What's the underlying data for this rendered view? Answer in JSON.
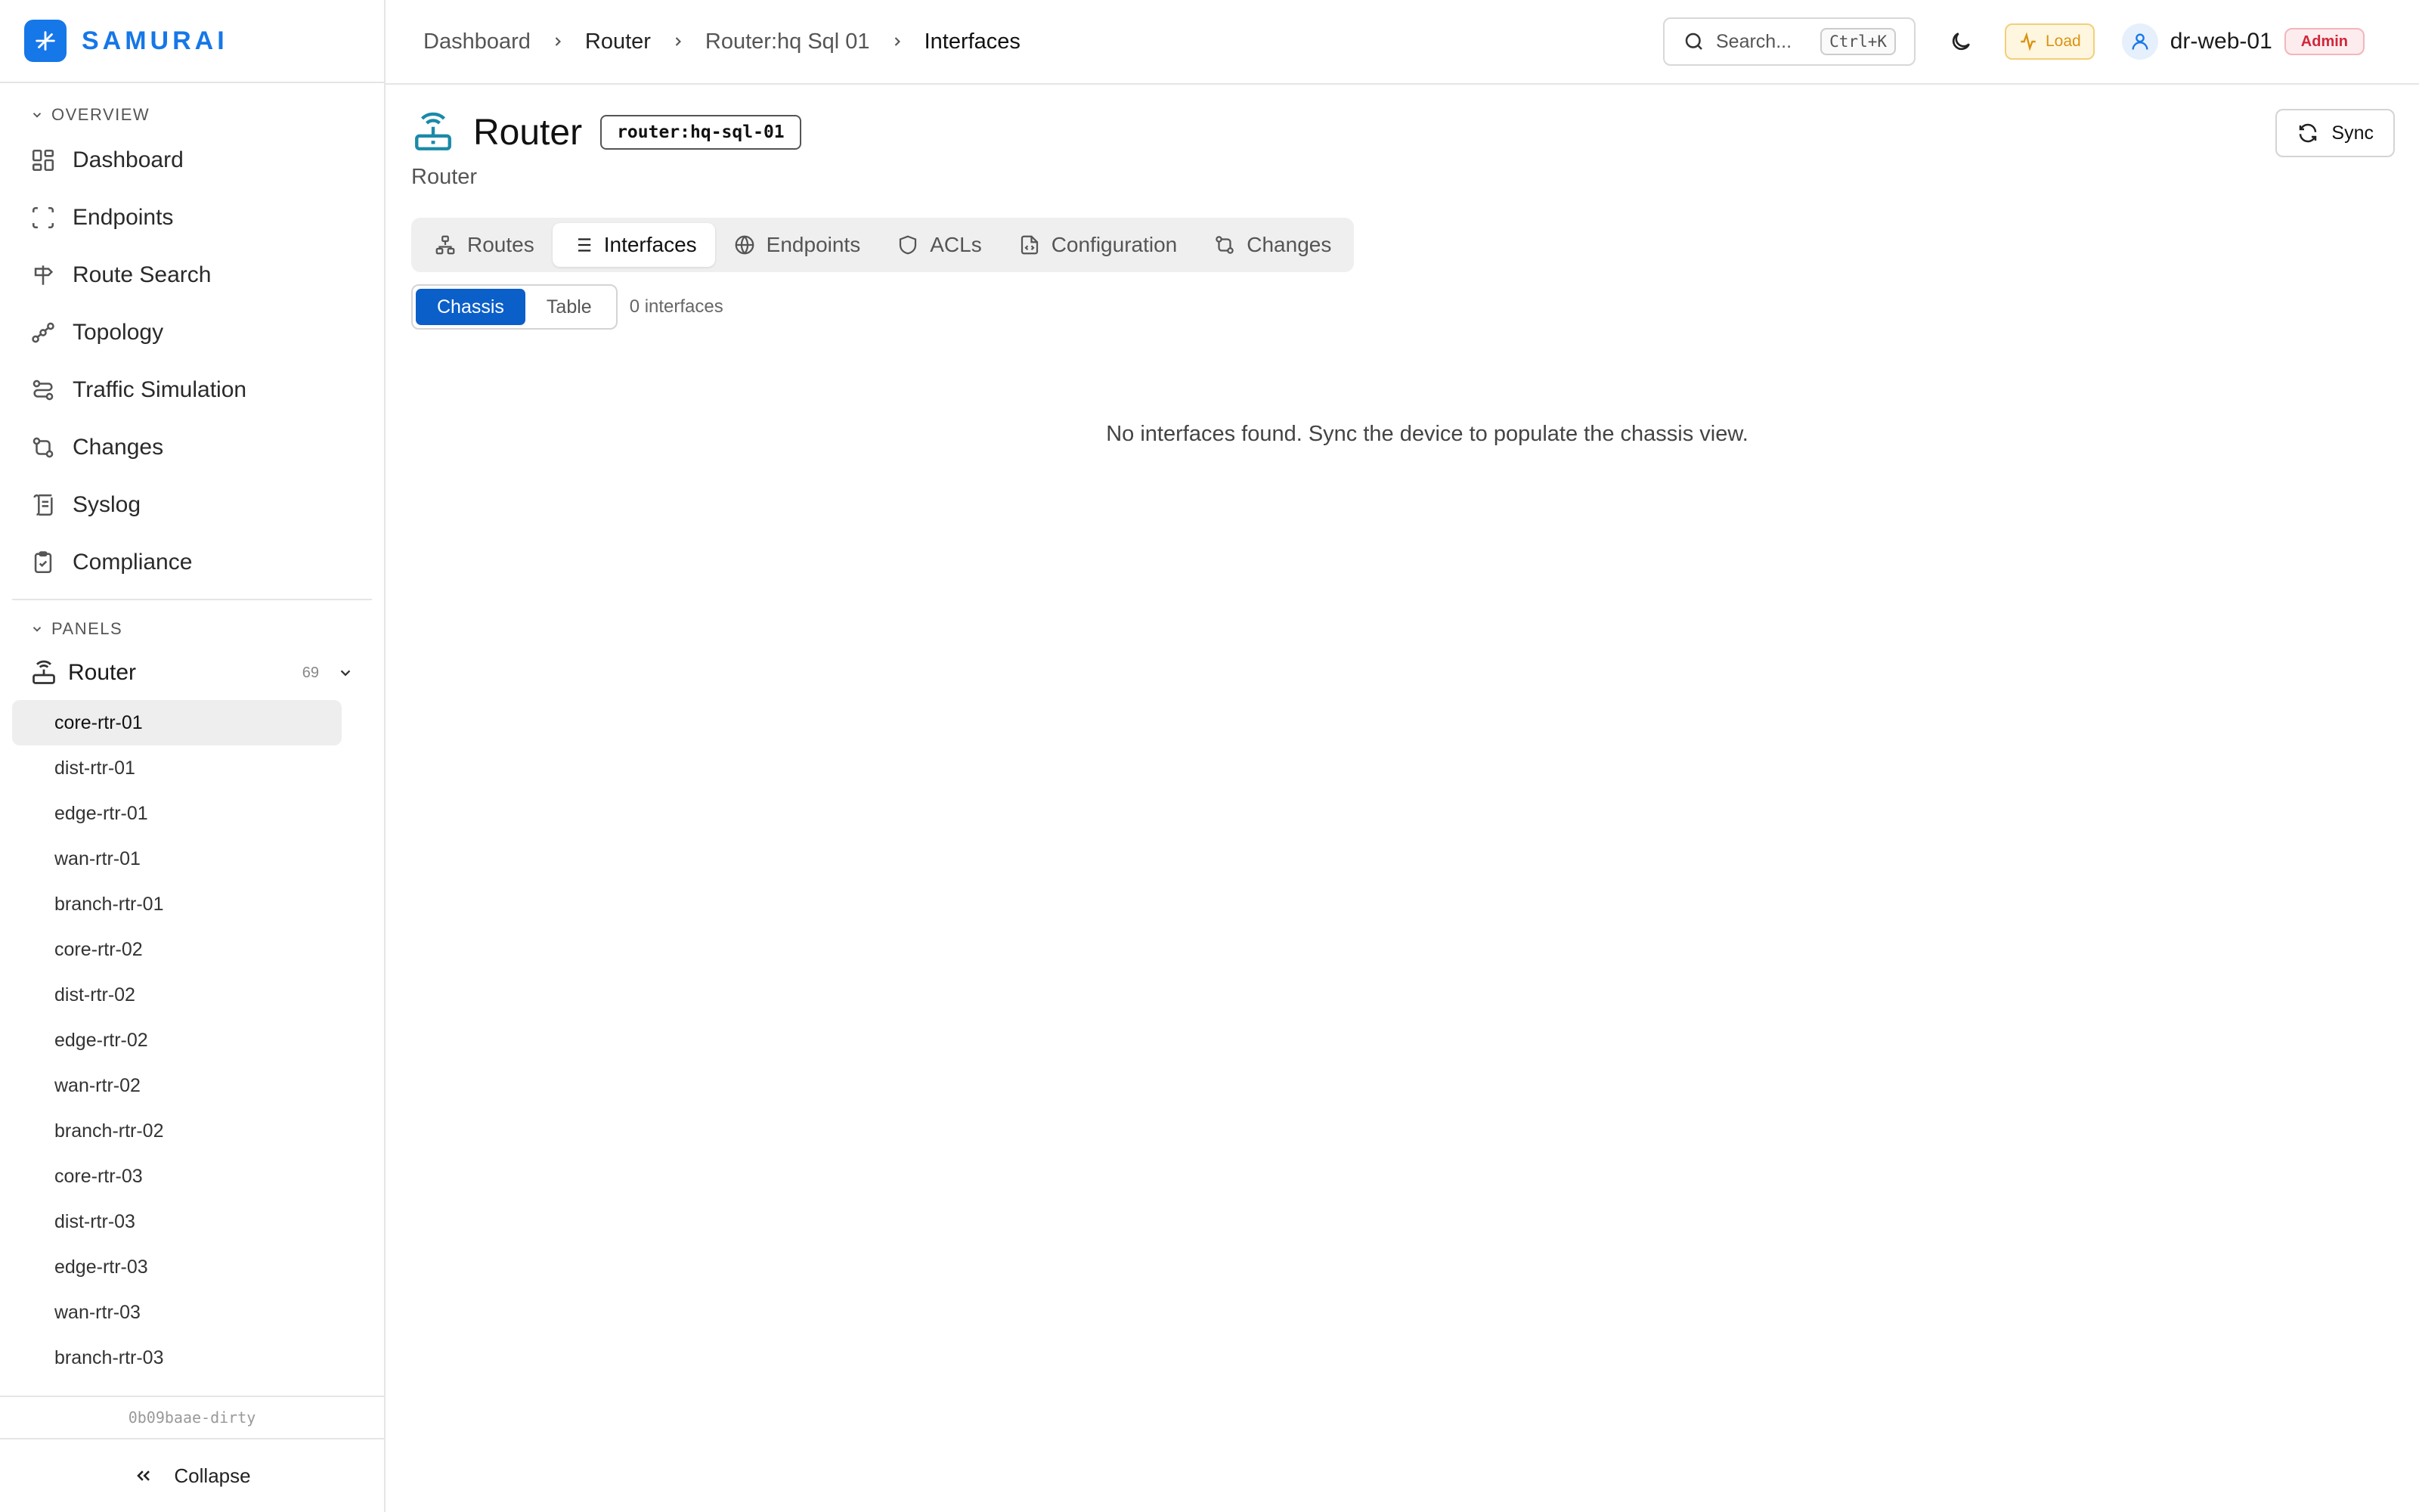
{
  "brand": {
    "name": "SAMURAI"
  },
  "sidebar": {
    "overview_label": "OVERVIEW",
    "items": [
      {
        "label": "Dashboard",
        "icon": "grid-icon"
      },
      {
        "label": "Endpoints",
        "icon": "scan-icon"
      },
      {
        "label": "Route Search",
        "icon": "signpost-icon"
      },
      {
        "label": "Topology",
        "icon": "topology-icon"
      },
      {
        "label": "Traffic Simulation",
        "icon": "traffic-icon"
      },
      {
        "label": "Changes",
        "icon": "git-compare-icon"
      },
      {
        "label": "Syslog",
        "icon": "scroll-icon"
      },
      {
        "label": "Compliance",
        "icon": "clipboard-check-icon"
      }
    ],
    "panels_label": "PANELS",
    "panel": {
      "label": "Router",
      "count": "69"
    },
    "routers": [
      "core-rtr-01",
      "dist-rtr-01",
      "edge-rtr-01",
      "wan-rtr-01",
      "branch-rtr-01",
      "core-rtr-02",
      "dist-rtr-02",
      "edge-rtr-02",
      "wan-rtr-02",
      "branch-rtr-02",
      "core-rtr-03",
      "dist-rtr-03",
      "edge-rtr-03",
      "wan-rtr-03",
      "branch-rtr-03"
    ],
    "active_router": "core-rtr-01",
    "version": "0b09baae-dirty",
    "collapse_label": "Collapse"
  },
  "header": {
    "breadcrumbs": [
      "Dashboard",
      "Router",
      "Router:hq Sql 01",
      "Interfaces"
    ],
    "search_placeholder": "Search...",
    "search_shortcut": "Ctrl+K",
    "load_label": "Load",
    "username": "dr-web-01",
    "role": "Admin"
  },
  "page": {
    "title": "Router",
    "device_id": "router:hq-sql-01",
    "subtitle": "Router",
    "sync_label": "Sync",
    "tabs": [
      {
        "label": "Routes",
        "icon": "route-icon"
      },
      {
        "label": "Interfaces",
        "icon": "list-icon"
      },
      {
        "label": "Endpoints",
        "icon": "globe-icon"
      },
      {
        "label": "ACLs",
        "icon": "shield-icon"
      },
      {
        "label": "Configuration",
        "icon": "file-code-icon"
      },
      {
        "label": "Changes",
        "icon": "git-compare-icon"
      }
    ],
    "active_tab": "Interfaces",
    "view_modes": [
      "Chassis",
      "Table"
    ],
    "active_view": "Chassis",
    "interface_count": "0 interfaces",
    "empty_message": "No interfaces found. Sync the device to populate the chassis view."
  },
  "colors": {
    "brand": "#1677e8",
    "active_segment": "#0b5fc9",
    "router_icon": "#1a8aa8",
    "load_text": "#d99312",
    "admin_text": "#d0263a"
  }
}
